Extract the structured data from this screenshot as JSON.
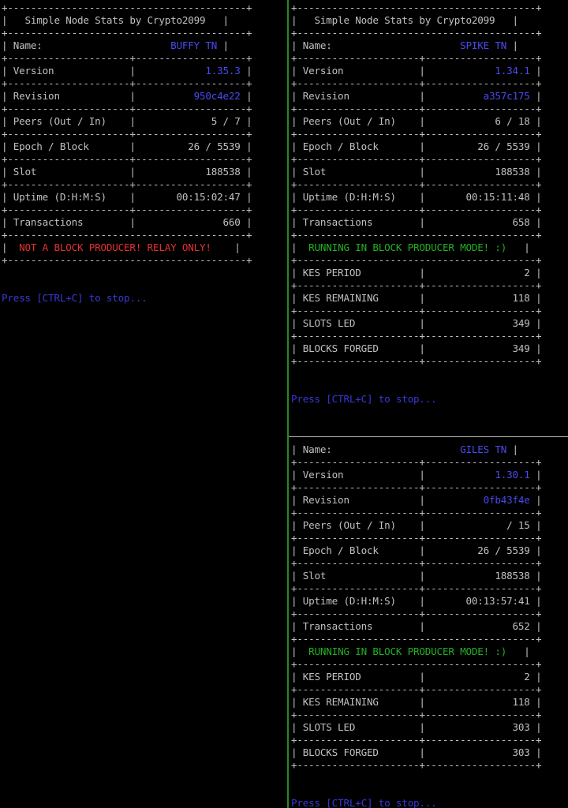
{
  "colors": {
    "background": "#000000",
    "text": "#c0c0c0",
    "value": "#4a4af0",
    "warning": "#e23030",
    "success": "#22b022",
    "divider": "#1f8f1f"
  },
  "panes": {
    "left": {
      "title": "Simple Node Stats by Crypto2099",
      "labels": {
        "name": "Name:",
        "version": "Version",
        "revision": "Revision",
        "peers": "Peers (Out / In)",
        "epoch": "Epoch / Block",
        "slot": "Slot",
        "uptime": "Uptime (D:H:M:S)",
        "transactions": "Transactions"
      },
      "values": {
        "name": "BUFFY TN",
        "version": "1.35.3",
        "revision": "950c4e22",
        "peers": "5 / 7",
        "epoch": "26 / 5539",
        "slot": "188538",
        "uptime": "00:15:02:47",
        "transactions": "660"
      },
      "mode_message": "NOT A BLOCK PRODUCER! RELAY ONLY!",
      "stop_hint": "Press [CTRL+C] to stop..."
    },
    "right_top": {
      "title": "Simple Node Stats by Crypto2099",
      "labels": {
        "name": "Name:",
        "version": "Version",
        "revision": "Revision",
        "peers": "Peers (Out / In)",
        "epoch": "Epoch / Block",
        "slot": "Slot",
        "uptime": "Uptime (D:H:M:S)",
        "transactions": "Transactions",
        "kes_period": "KES PERIOD",
        "kes_remaining": "KES REMAINING",
        "slots_led": "SLOTS LED",
        "blocks_forged": "BLOCKS FORGED"
      },
      "values": {
        "name": "SPIKE TN",
        "version": "1.34.1",
        "revision": "a357c175",
        "peers": "6 / 18",
        "epoch": "26 / 5539",
        "slot": "188538",
        "uptime": "00:15:11:48",
        "transactions": "658",
        "kes_period": "2",
        "kes_remaining": "118",
        "slots_led": "349",
        "blocks_forged": "349"
      },
      "mode_message": "RUNNING IN BLOCK PRODUCER MODE! :)",
      "stop_hint": "Press [CTRL+C] to stop..."
    },
    "right_bottom": {
      "labels": {
        "name": "Name:",
        "version": "Version",
        "revision": "Revision",
        "peers": "Peers (Out / In)",
        "epoch": "Epoch / Block",
        "slot": "Slot",
        "uptime": "Uptime (D:H:M:S)",
        "transactions": "Transactions",
        "kes_period": "KES PERIOD",
        "kes_remaining": "KES REMAINING",
        "slots_led": "SLOTS LED",
        "blocks_forged": "BLOCKS FORGED"
      },
      "values": {
        "name": "GILES TN",
        "version": "1.30.1",
        "revision": "0fb43f4e",
        "peers": "/ 15",
        "epoch": "26 / 5539",
        "slot": "188538",
        "uptime": "00:13:57:41",
        "transactions": "652",
        "kes_period": "2",
        "kes_remaining": "118",
        "slots_led": "303",
        "blocks_forged": "303"
      },
      "mode_message": "RUNNING IN BLOCK PRODUCER MODE! :)",
      "stop_hint": "Press [CTRL+C] to stop..."
    }
  }
}
